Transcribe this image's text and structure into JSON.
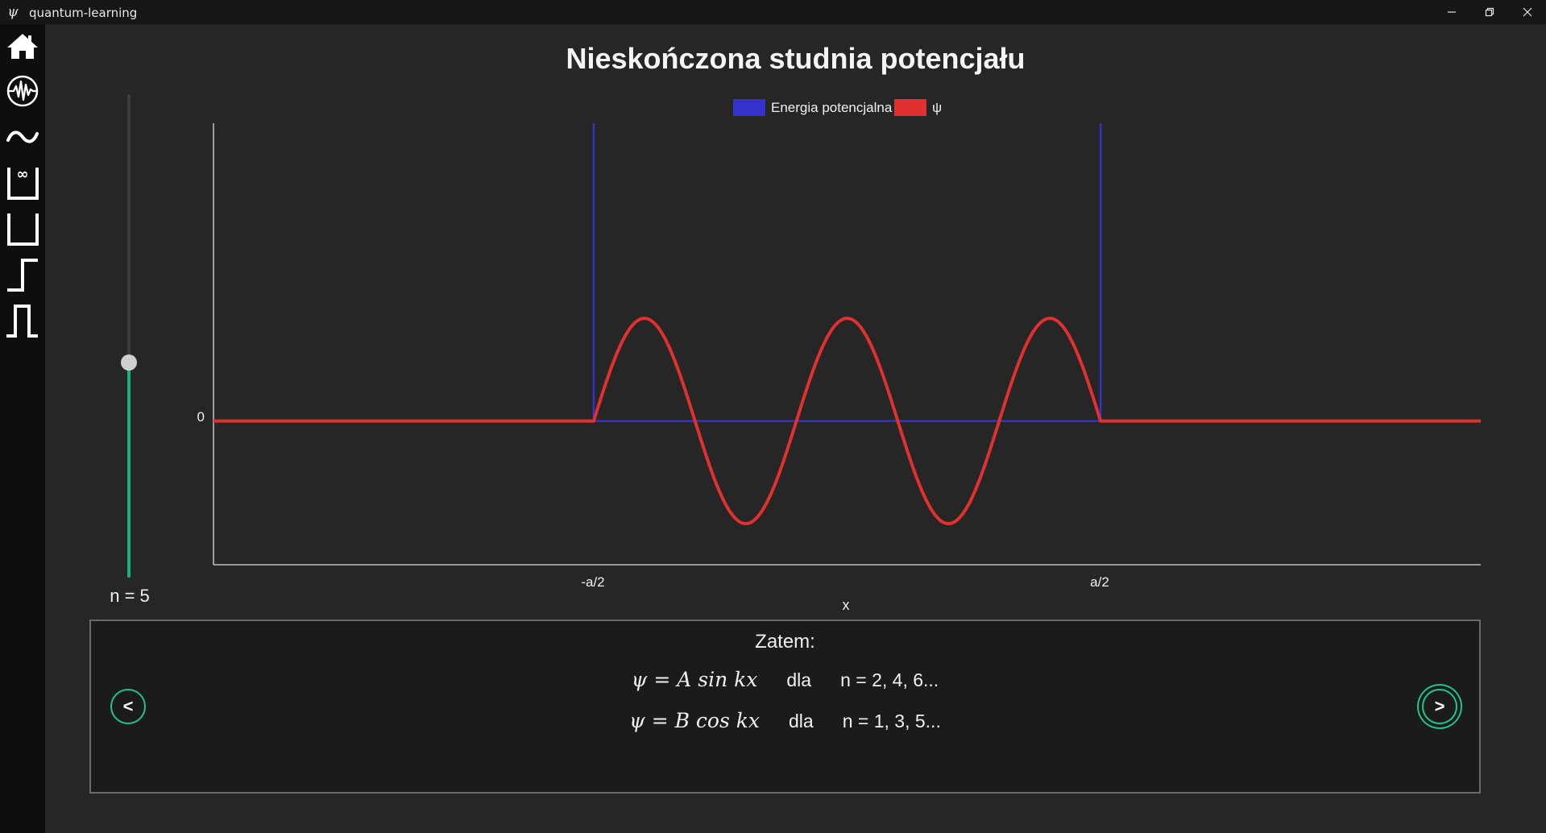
{
  "window": {
    "title": "quantum-learning",
    "app_icon": "psi-icon",
    "app_icon_glyph": "ψ",
    "controls": [
      "minimize-icon",
      "restore-icon",
      "close-icon"
    ]
  },
  "sidebar": {
    "items": [
      {
        "name": "home",
        "icon": "home-icon"
      },
      {
        "name": "wave",
        "icon": "wave-circle-icon"
      },
      {
        "name": "free-particle",
        "icon": "tilde-wave-icon"
      },
      {
        "name": "infinite-well",
        "icon": "infinite-well-icon"
      },
      {
        "name": "finite-well",
        "icon": "finite-well-icon"
      },
      {
        "name": "potential-step",
        "icon": "step-icon"
      },
      {
        "name": "potential-barrier",
        "icon": "barrier-icon"
      }
    ]
  },
  "page": {
    "title": "Nieskończona studnia potencjału"
  },
  "slider": {
    "label": "n = 5",
    "value": 5,
    "min": 1,
    "max": 10,
    "fill_color": "#18b274"
  },
  "chart_data": {
    "type": "line",
    "title": "",
    "xlabel": "x",
    "ylabel": "",
    "x_ticks": [
      "-a/2",
      "a/2"
    ],
    "y_ticks": [
      "0"
    ],
    "legend": {
      "placement": "top-center",
      "entries": [
        {
          "name": "Energia potencjalna",
          "color": "#3333cc"
        },
        {
          "name": "ψ",
          "color": "#e03030"
        }
      ]
    },
    "x_domain": [
      -1.25,
      1.25
    ],
    "y_domain": [
      -1.4,
      2.9
    ],
    "grid": false,
    "series": [
      {
        "name": "Energia potencjalna",
        "color": "#3333cc",
        "kind": "infinite-well",
        "walls_at": [
          -0.5,
          0.5
        ],
        "floor": 0
      },
      {
        "name": "ψ",
        "color": "#e03030",
        "n": 5,
        "function": "cos",
        "amplitude": 1,
        "support": [
          -0.5,
          0.5
        ],
        "outside_value": 0
      }
    ]
  },
  "info": {
    "heading": "Zatem:",
    "rows": [
      {
        "formula": "ψ = A sin kx",
        "word": "dla",
        "condition": "n = 2, 4, 6..."
      },
      {
        "formula": "ψ = B cos kx",
        "word": "dla",
        "condition": "n = 1, 3, 5..."
      }
    ]
  },
  "navigation": {
    "prev_label": "<",
    "next_label": ">",
    "accent": "#1fc48a"
  }
}
